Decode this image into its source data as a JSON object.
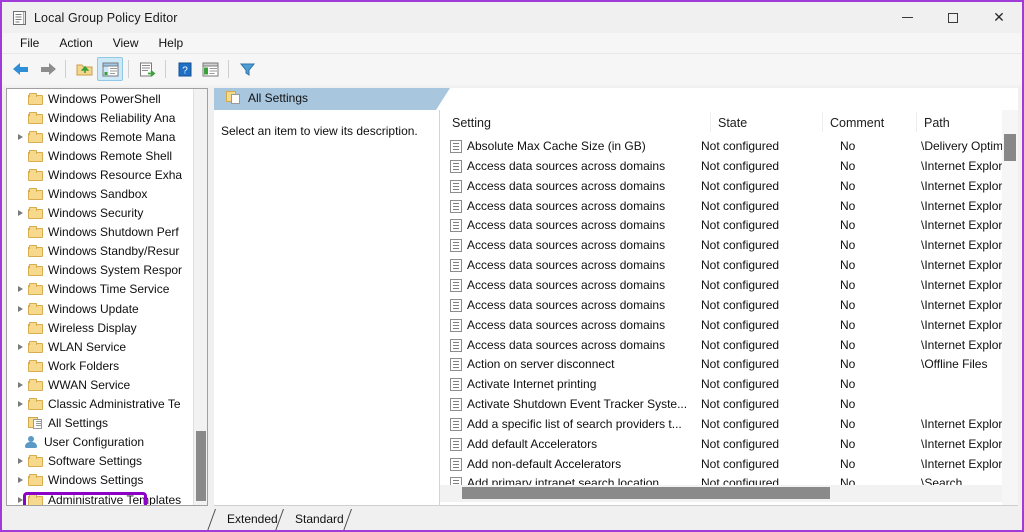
{
  "window": {
    "title": "Local Group Policy Editor",
    "icon": "policy-editor-icon",
    "controls": {
      "minimize": "minimize",
      "maximize": "maximize",
      "close": "close"
    },
    "border_color": "#a03ad8"
  },
  "menubar": {
    "items": [
      "File",
      "Action",
      "View",
      "Help"
    ]
  },
  "toolbar": {
    "items": [
      {
        "name": "back",
        "icon": "back-arrow-icon"
      },
      {
        "name": "forward",
        "icon": "forward-arrow-icon"
      },
      {
        "name": "up-one-level",
        "icon": "up-folder-icon"
      },
      {
        "name": "show-hide-console-tree",
        "icon": "console-tree-icon",
        "selected": true
      },
      {
        "name": "export-list",
        "icon": "export-list-icon"
      },
      {
        "name": "help",
        "icon": "help-question-icon"
      },
      {
        "name": "show-hide-action-pane",
        "icon": "action-pane-icon"
      },
      {
        "name": "filter",
        "icon": "filter-funnel-icon"
      }
    ]
  },
  "tree": {
    "highlight_color": "#8d00c8",
    "items": [
      {
        "label": "Windows PowerShell",
        "expandable": false,
        "icon": "folder-icon",
        "indent": 1
      },
      {
        "label": "Windows Reliability Ana",
        "expandable": false,
        "icon": "folder-icon",
        "indent": 1
      },
      {
        "label": "Windows Remote Mana",
        "expandable": true,
        "icon": "folder-icon",
        "indent": 1
      },
      {
        "label": "Windows Remote Shell",
        "expandable": false,
        "icon": "folder-icon",
        "indent": 1
      },
      {
        "label": "Windows Resource Exha",
        "expandable": false,
        "icon": "folder-icon",
        "indent": 1
      },
      {
        "label": "Windows Sandbox",
        "expandable": false,
        "icon": "folder-icon",
        "indent": 1
      },
      {
        "label": "Windows Security",
        "expandable": true,
        "icon": "folder-icon",
        "indent": 1
      },
      {
        "label": "Windows Shutdown Perf",
        "expandable": false,
        "icon": "folder-icon",
        "indent": 1
      },
      {
        "label": "Windows Standby/Resur",
        "expandable": false,
        "icon": "folder-icon",
        "indent": 1
      },
      {
        "label": "Windows System Respor",
        "expandable": false,
        "icon": "folder-icon",
        "indent": 1
      },
      {
        "label": "Windows Time Service",
        "expandable": true,
        "icon": "folder-icon",
        "indent": 1
      },
      {
        "label": "Windows Update",
        "expandable": true,
        "icon": "folder-icon",
        "indent": 1
      },
      {
        "label": "Wireless Display",
        "expandable": false,
        "icon": "folder-icon",
        "indent": 1
      },
      {
        "label": "WLAN Service",
        "expandable": true,
        "icon": "folder-icon",
        "indent": 1
      },
      {
        "label": "Work Folders",
        "expandable": false,
        "icon": "folder-icon",
        "indent": 1
      },
      {
        "label": "WWAN Service",
        "expandable": true,
        "icon": "folder-icon",
        "indent": 1
      },
      {
        "label": "Classic Administrative Te",
        "expandable": true,
        "icon": "folder-icon",
        "indent": 1
      },
      {
        "label": "All Settings",
        "expandable": false,
        "icon": "all-settings-icon",
        "indent": 1,
        "highlighted": true
      },
      {
        "label": "User Configuration",
        "expandable": false,
        "icon": "user-configuration-icon",
        "indent": 0
      },
      {
        "label": "Software Settings",
        "expandable": true,
        "icon": "folder-icon",
        "indent": 1
      },
      {
        "label": "Windows Settings",
        "expandable": true,
        "icon": "folder-icon",
        "indent": 1
      },
      {
        "label": "Administrative Templates",
        "expandable": true,
        "icon": "folder-icon",
        "indent": 1
      }
    ]
  },
  "right_pane": {
    "tab_title": "All Settings",
    "tab_icon": "all-settings-icon",
    "description": "Select an item to view its description.",
    "columns": [
      "Setting",
      "State",
      "Comment",
      "Path"
    ],
    "rows": [
      {
        "setting": "Absolute Max Cache Size (in GB)",
        "state": "Not configured",
        "comment": "No",
        "path": "\\Delivery Optimiz"
      },
      {
        "setting": "Access data sources across domains",
        "state": "Not configured",
        "comment": "No",
        "path": "\\Internet Explorer"
      },
      {
        "setting": "Access data sources across domains",
        "state": "Not configured",
        "comment": "No",
        "path": "\\Internet Explorer"
      },
      {
        "setting": "Access data sources across domains",
        "state": "Not configured",
        "comment": "No",
        "path": "\\Internet Explorer"
      },
      {
        "setting": "Access data sources across domains",
        "state": "Not configured",
        "comment": "No",
        "path": "\\Internet Explorer"
      },
      {
        "setting": "Access data sources across domains",
        "state": "Not configured",
        "comment": "No",
        "path": "\\Internet Explorer"
      },
      {
        "setting": "Access data sources across domains",
        "state": "Not configured",
        "comment": "No",
        "path": "\\Internet Explorer"
      },
      {
        "setting": "Access data sources across domains",
        "state": "Not configured",
        "comment": "No",
        "path": "\\Internet Explorer"
      },
      {
        "setting": "Access data sources across domains",
        "state": "Not configured",
        "comment": "No",
        "path": "\\Internet Explorer"
      },
      {
        "setting": "Access data sources across domains",
        "state": "Not configured",
        "comment": "No",
        "path": "\\Internet Explorer"
      },
      {
        "setting": "Access data sources across domains",
        "state": "Not configured",
        "comment": "No",
        "path": "\\Internet Explorer"
      },
      {
        "setting": "Action on server disconnect",
        "state": "Not configured",
        "comment": "No",
        "path": "\\Offline Files"
      },
      {
        "setting": "Activate Internet printing",
        "state": "Not configured",
        "comment": "No",
        "path": ""
      },
      {
        "setting": "Activate Shutdown Event Tracker Syste...",
        "state": "Not configured",
        "comment": "No",
        "path": ""
      },
      {
        "setting": "Add a specific list of search providers t...",
        "state": "Not configured",
        "comment": "No",
        "path": "\\Internet Explorer"
      },
      {
        "setting": "Add default Accelerators",
        "state": "Not configured",
        "comment": "No",
        "path": "\\Internet Explorer"
      },
      {
        "setting": "Add non-default Accelerators",
        "state": "Not configured",
        "comment": "No",
        "path": "\\Internet Explorer"
      },
      {
        "setting": "Add primary intranet search location",
        "state": "Not configured",
        "comment": "No",
        "path": "\\Search"
      }
    ]
  },
  "bottom_tabs": [
    {
      "label": "Extended",
      "active": false
    },
    {
      "label": "Standard",
      "active": true
    }
  ]
}
